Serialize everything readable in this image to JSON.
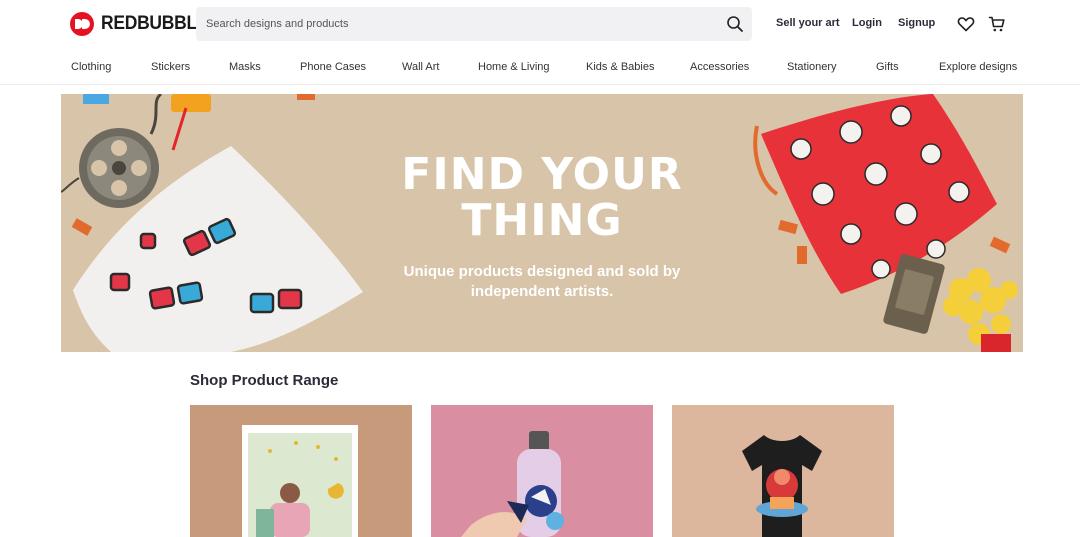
{
  "brand": {
    "name": "REDBUBBLE",
    "accent": "#e41321"
  },
  "search": {
    "placeholder": "Search designs and products",
    "icon": "search-icon"
  },
  "header": {
    "sell_label": "Sell your art",
    "login_label": "Login",
    "signup_label": "Signup",
    "wishlist_icon": "heart-icon",
    "cart_icon": "cart-icon"
  },
  "nav": {
    "items": [
      {
        "label": "Clothing"
      },
      {
        "label": "Stickers"
      },
      {
        "label": "Masks"
      },
      {
        "label": "Phone Cases"
      },
      {
        "label": "Wall Art"
      },
      {
        "label": "Home & Living"
      },
      {
        "label": "Kids & Babies"
      },
      {
        "label": "Accessories"
      },
      {
        "label": "Stationery"
      },
      {
        "label": "Gifts"
      },
      {
        "label": "Explore designs"
      }
    ]
  },
  "hero": {
    "title_line1": "FIND YOUR",
    "title_line2": "THING",
    "subtitle_line1": "Unique products designed and sold by",
    "subtitle_line2": "independent artists.",
    "background": "#d8c4a8"
  },
  "product_range": {
    "title": "Shop Product Range",
    "cards": [
      {
        "name": "art-print",
        "background": "#c69a7a"
      },
      {
        "name": "water-bottle-stickers",
        "background": "#d98ea2"
      },
      {
        "name": "t-shirt",
        "background": "#dcb79d"
      }
    ]
  }
}
